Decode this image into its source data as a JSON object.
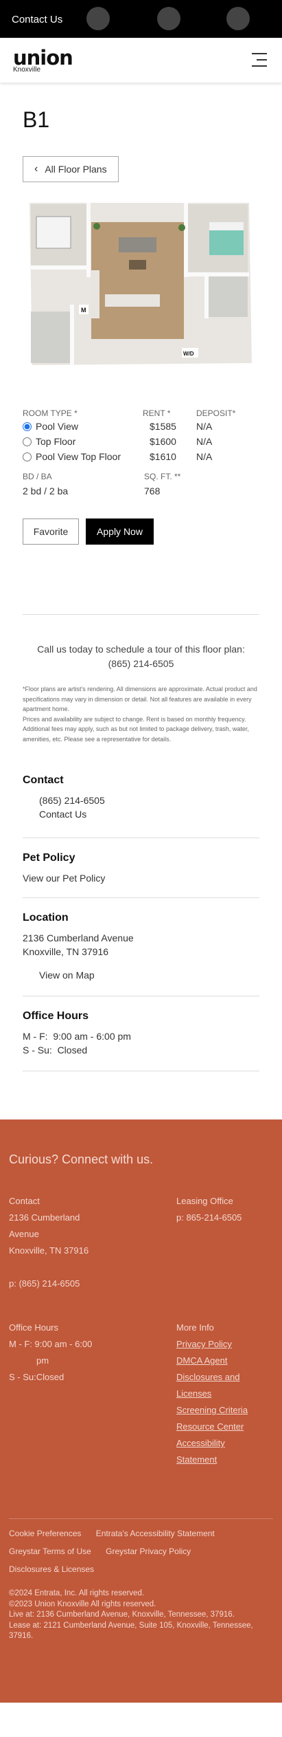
{
  "topbar": {
    "contact_label": "Contact Us"
  },
  "header": {
    "logo_word": "union",
    "logo_sub": "Knoxville"
  },
  "plan": {
    "name": "B1",
    "back_label": "All Floor Plans",
    "floorplan_label_m": "M",
    "floorplan_label_wd": "W/D"
  },
  "specs": {
    "room_type_label": "ROOM TYPE *",
    "rent_label": "RENT *",
    "deposit_label": "DEPOSIT*",
    "rows": [
      {
        "type": "Pool View",
        "rent": "$1585",
        "deposit": "N/A",
        "selected": true
      },
      {
        "type": "Top Floor",
        "rent": "$1600",
        "deposit": "N/A",
        "selected": false
      },
      {
        "type": "Pool View Top Floor",
        "rent": "$1610",
        "deposit": "N/A",
        "selected": false
      }
    ],
    "bdba_label": "BD / BA",
    "bdba_value": "2 bd / 2 ba",
    "sqft_label": "SQ. FT. **",
    "sqft_value": "768"
  },
  "actions": {
    "favorite": "Favorite",
    "apply": "Apply Now"
  },
  "call": {
    "text": "Call us today to schedule a tour of this floor plan:",
    "phone": "(865) 214-6505"
  },
  "disclaimer": {
    "p1": "*Floor plans are artist's rendering. All dimensions are approximate. Actual product and specifications may vary in dimension or detail. Not all features are available in every apartment home.",
    "p2": "Prices and availability are subject to change. Rent is based on monthly frequency. Additional fees may apply, such as but not limited to package delivery, trash, water, amenities, etc. Please see a representative for details."
  },
  "contact": {
    "title": "Contact",
    "phone": "(865) 214-6505",
    "link": "Contact Us"
  },
  "pet": {
    "title": "Pet Policy",
    "link": "View our Pet Policy"
  },
  "location": {
    "title": "Location",
    "street": "2136 Cumberland Avenue",
    "city": "Knoxville, TN 37916",
    "map_link": "View on Map"
  },
  "hours": {
    "title": "Office Hours",
    "weekday": "M - F:  9:00 am - 6:00 pm",
    "weekend": "S - Su:  Closed"
  },
  "footer": {
    "heading": "Curious? Connect with us.",
    "contact_title": "Contact",
    "contact_lines": [
      "2136 Cumberland",
      "Avenue",
      "Knoxville, TN 37916"
    ],
    "contact_phone": "p: (865) 214-6505",
    "leasing_title": "Leasing Office",
    "leasing_phone": "p: 865-214-6505",
    "hours_title": "Office Hours",
    "hours_weekday_1": "M - F: 9:00 am - 6:00",
    "hours_weekday_2": "pm",
    "hours_weekend": "S - Su:Closed",
    "more_title": "More Info",
    "more_links": [
      "Privacy Policy",
      "DMCA Agent",
      "Disclosures and",
      "Licenses",
      "Screening Criteria",
      "Resource Center",
      "Accessibility",
      "Statement"
    ],
    "bottom_links_row1": [
      "Cookie Preferences",
      "Entrata's Accessibility Statement"
    ],
    "bottom_links_row2": [
      "Greystar Terms of Use",
      "Greystar Privacy Policy"
    ],
    "bottom_links_row3": [
      "Disclosures & Licenses"
    ],
    "copyright_1": "©2024 Entrata, Inc. All rights reserved.",
    "copyright_2": "©2023 Union Knoxville All rights reserved.",
    "live_at": "Live at: 2136 Cumberland Avenue, Knoxville, Tennessee, 37916.",
    "lease_at": "Lease at: 2121 Cumberland Avenue, Suite 105, Knoxville, Tennessee, 37916."
  },
  "colors": {
    "footer_bg": "#c0583a",
    "topbar_bg": "#000000",
    "accent_radio": "#1a73e8"
  },
  "icons": {
    "back": "chevron-left-icon",
    "menu": "hamburger-icon"
  }
}
